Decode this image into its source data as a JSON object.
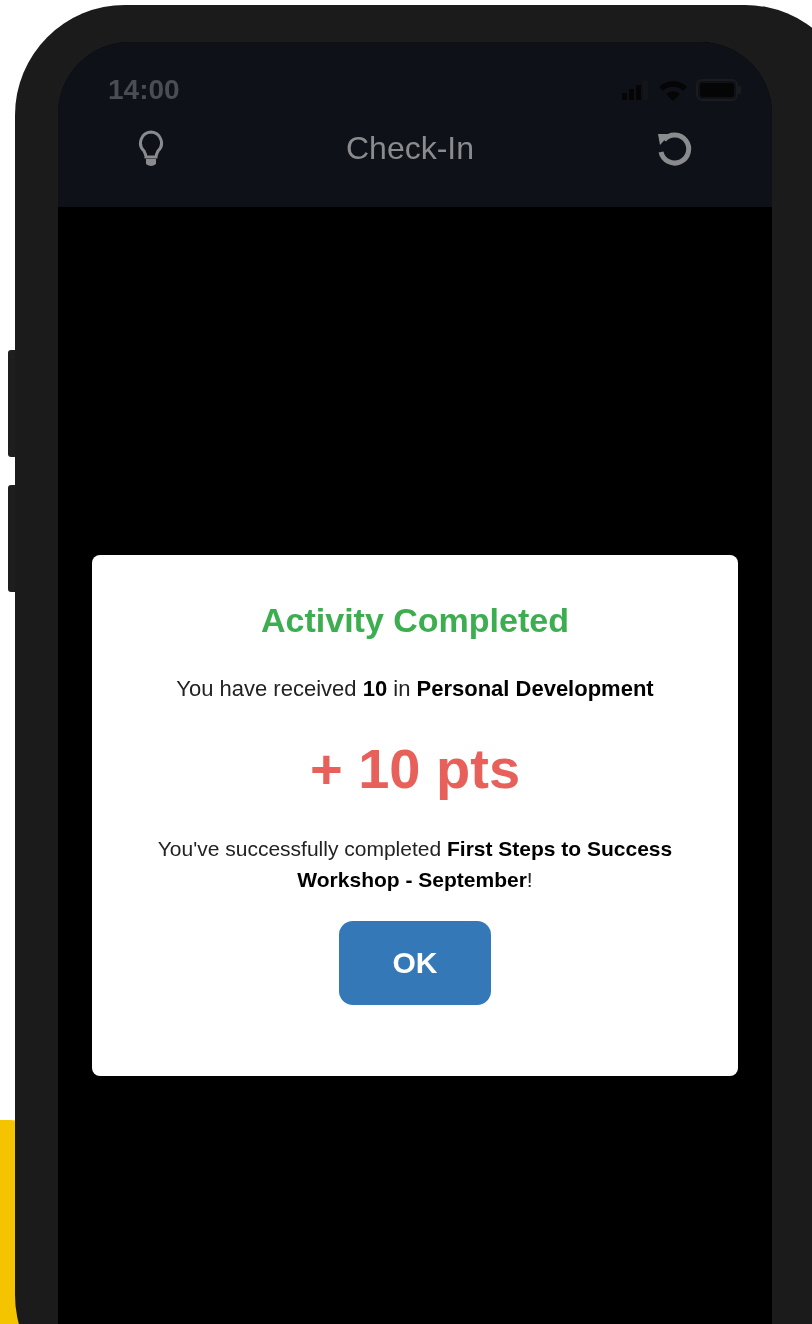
{
  "status_bar": {
    "time": "14:00"
  },
  "header": {
    "title": "Check-In"
  },
  "dialog": {
    "title": "Activity Completed",
    "message": "You have received **10** in **Personal Development**",
    "points": "+ 10 pts",
    "detail": "You've successfully completed **First Steps to Success Workshop - September**!",
    "button": "OK"
  }
}
